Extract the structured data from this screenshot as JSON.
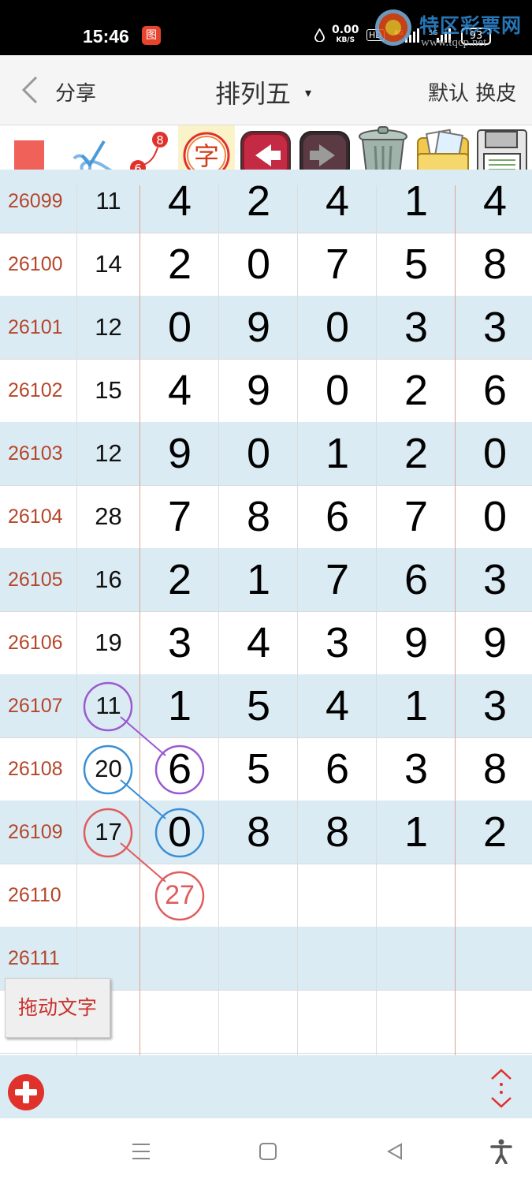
{
  "status_bar": {
    "time": "15:46",
    "app_badge": "图",
    "net_speed_value": "0.00",
    "net_speed_unit": "KB/S",
    "hd_label": "HD",
    "signal_4g": "4G",
    "signal_5g": "5G",
    "battery": "93"
  },
  "watermark": {
    "site_name": "特区彩票网",
    "site_url": "www.tqcp.net"
  },
  "nav": {
    "share_label": "分享",
    "title": "排列五",
    "title_dropdown": "▾",
    "default_label": "默认",
    "skin_label": "换皮"
  },
  "toolbar": {
    "icons": [
      "red-square",
      "check-swirl",
      "number-link",
      "text-char",
      "undo-arrow",
      "redo-arrow",
      "trash-bin",
      "gallery-folder",
      "save-disk"
    ],
    "number_link_a": "6",
    "number_link_b": "8",
    "text_char": "字"
  },
  "rows": [
    {
      "issue": "26099",
      "sum": "11",
      "digits": [
        "4",
        "2",
        "4",
        "1",
        "4"
      ]
    },
    {
      "issue": "26100",
      "sum": "14",
      "digits": [
        "2",
        "0",
        "7",
        "5",
        "8"
      ]
    },
    {
      "issue": "26101",
      "sum": "12",
      "digits": [
        "0",
        "9",
        "0",
        "3",
        "3"
      ]
    },
    {
      "issue": "26102",
      "sum": "15",
      "digits": [
        "4",
        "9",
        "0",
        "2",
        "6"
      ]
    },
    {
      "issue": "26103",
      "sum": "12",
      "digits": [
        "9",
        "0",
        "1",
        "2",
        "0"
      ]
    },
    {
      "issue": "26104",
      "sum": "28",
      "digits": [
        "7",
        "8",
        "6",
        "7",
        "0"
      ]
    },
    {
      "issue": "26105",
      "sum": "16",
      "digits": [
        "2",
        "1",
        "7",
        "6",
        "3"
      ]
    },
    {
      "issue": "26106",
      "sum": "19",
      "digits": [
        "3",
        "4",
        "3",
        "9",
        "9"
      ]
    },
    {
      "issue": "26107",
      "sum": "11",
      "digits": [
        "1",
        "5",
        "4",
        "1",
        "3"
      ]
    },
    {
      "issue": "26108",
      "sum": "20",
      "digits": [
        "6",
        "5",
        "6",
        "3",
        "8"
      ]
    },
    {
      "issue": "26109",
      "sum": "17",
      "digits": [
        "0",
        "8",
        "8",
        "1",
        "2"
      ]
    },
    {
      "issue": "26110",
      "sum": "",
      "digits": [
        "27",
        "",
        "",
        "",
        ""
      ]
    },
    {
      "issue": "26111",
      "sum": "",
      "digits": [
        "",
        "",
        "",
        "",
        ""
      ]
    },
    {
      "issue": "",
      "sum": "",
      "digits": [
        "",
        "",
        "",
        "",
        ""
      ]
    }
  ],
  "annotations": {
    "colors": {
      "purple": "#9b59d0",
      "blue": "#3a8fd6",
      "red": "#e05c5c"
    }
  },
  "drag_text_button": "拖动文字",
  "colors": {
    "issue_text": "#b5462a",
    "row_blue": "#dbebf4",
    "accent_red": "#e0312b"
  }
}
